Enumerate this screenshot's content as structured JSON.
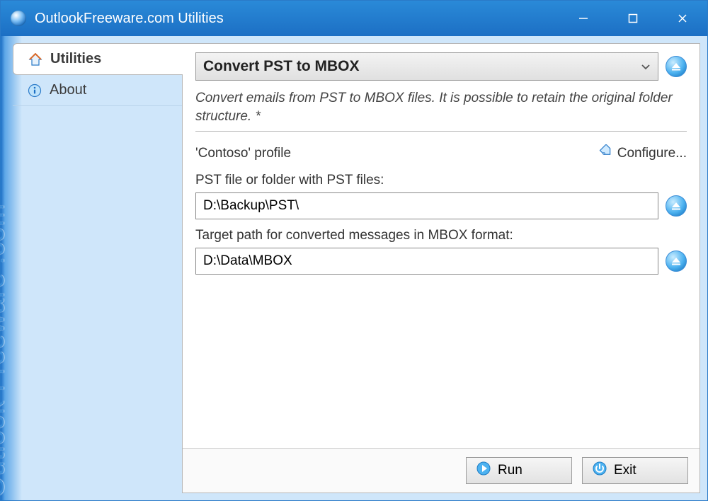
{
  "window": {
    "title": "OutlookFreeware.com Utilities"
  },
  "brand": "Outlook Freeware .com",
  "sidebar": {
    "tabs": [
      {
        "label": "Utilities"
      },
      {
        "label": "About"
      }
    ]
  },
  "main": {
    "header_title": "Convert PST to MBOX",
    "description": "Convert emails from PST to MBOX files. It is possible to retain the original folder structure. *",
    "profile_text": "'Contoso' profile",
    "configure_label": "Configure...",
    "pst_label": "PST file or folder with PST files:",
    "pst_value": "D:\\Backup\\PST\\",
    "target_label": "Target path for converted messages in MBOX format:",
    "target_value": "D:\\Data\\MBOX"
  },
  "footer": {
    "run": "Run",
    "exit": "Exit"
  }
}
